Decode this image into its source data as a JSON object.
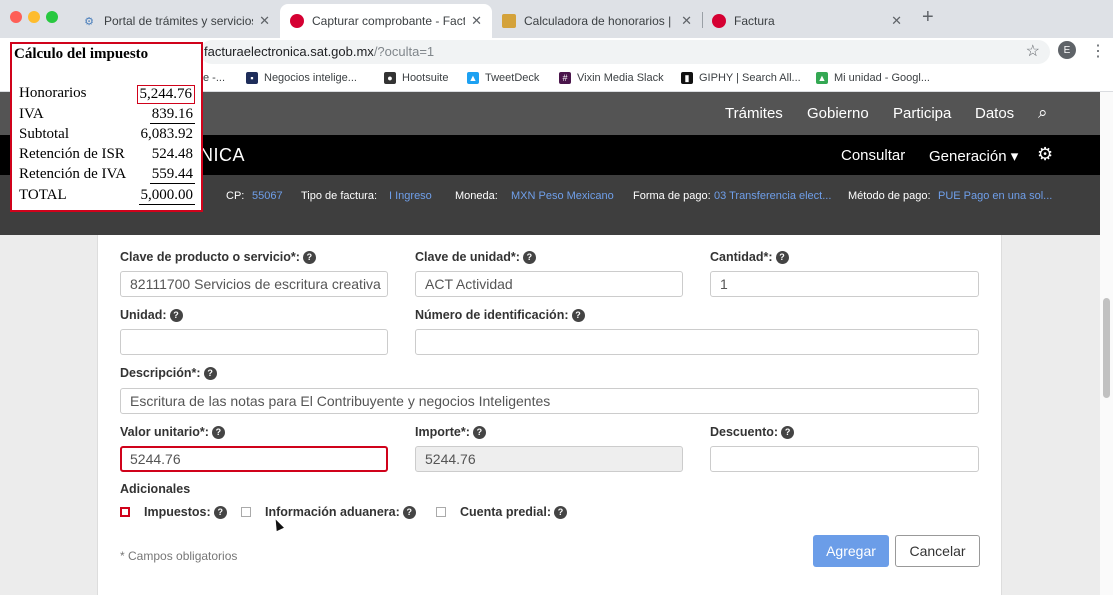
{
  "browser": {
    "tabs": [
      {
        "title": "Portal de trámites y servicios -",
        "favicon_color": "#4a7ebb"
      },
      {
        "title": "Capturar comprobante - Factu",
        "favicon_color": "#d50032"
      },
      {
        "title": "Calculadora de honorarios | el",
        "favicon_color": "#d4a23a"
      },
      {
        "title": "Factura",
        "favicon_color": "#d50032"
      }
    ],
    "url_visible": "facturaelectronica.sat.gob.mx",
    "url_rest": "/?oculta=1",
    "profile_letter": "E",
    "bookmarks": [
      "Negocios intelige...",
      "Hootsuite",
      "TweetDeck",
      "Vixin Media Slack",
      "GIPHY | Search All...",
      "Mi unidad - Googl..."
    ],
    "bookmark_partial": "e -..."
  },
  "site": {
    "topnav": [
      "Trámites",
      "Gobierno",
      "Participa",
      "Datos"
    ],
    "brand": "NICA",
    "subnav": [
      "Consultar",
      "Generación ▾"
    ],
    "info": {
      "cp_label": "CP:",
      "cp_value": "55067",
      "tipo_label": "Tipo de factura:",
      "tipo_value": "I Ingreso",
      "moneda_label": "Moneda:",
      "moneda_value": "MXN Peso Mexicano",
      "forma_label": "Forma de pago:",
      "forma_value": "03 Transferencia elect...",
      "metodo_label": "Método de pago:",
      "metodo_value": "PUE Pago en una sol..."
    }
  },
  "form": {
    "clave_producto_label": "Clave de producto o servicio*:",
    "clave_producto_value": "82111700 Servicios de escritura creativa",
    "clave_unidad_label": "Clave de unidad*:",
    "clave_unidad_value": "ACT Actividad",
    "cantidad_label": "Cantidad*:",
    "cantidad_value": "1",
    "unidad_label": "Unidad:",
    "unidad_value": "",
    "numero_label": "Número de identificación:",
    "numero_value": "",
    "descripcion_label": "Descripción*:",
    "descripcion_value": "Escritura de las notas para El Contribuyente y negocios Inteligentes",
    "valor_label": "Valor unitario*:",
    "valor_value": "5244.76",
    "importe_label": "Importe*:",
    "importe_value": "5244.76",
    "descuento_label": "Descuento:",
    "descuento_value": "",
    "adicionales_label": "Adicionales",
    "impuestos_label": "Impuestos:",
    "aduanera_label": "Información aduanera:",
    "predial_label": "Cuenta predial:",
    "required_note": "* Campos obligatorios",
    "agregar_label": "Agregar",
    "cancelar_label": "Cancelar"
  },
  "tax_overlay": {
    "title": "Cálculo del impuesto",
    "rows": [
      {
        "label": "Honorarios",
        "value": "5,244.76"
      },
      {
        "label": "IVA",
        "value": "839.16"
      },
      {
        "label": "Subtotal",
        "value": "6,083.92"
      },
      {
        "label": "Retención de ISR",
        "value": "524.48"
      },
      {
        "label": "Retención de IVA",
        "value": "559.44"
      },
      {
        "label": "TOTAL",
        "value": "5,000.00"
      }
    ]
  }
}
